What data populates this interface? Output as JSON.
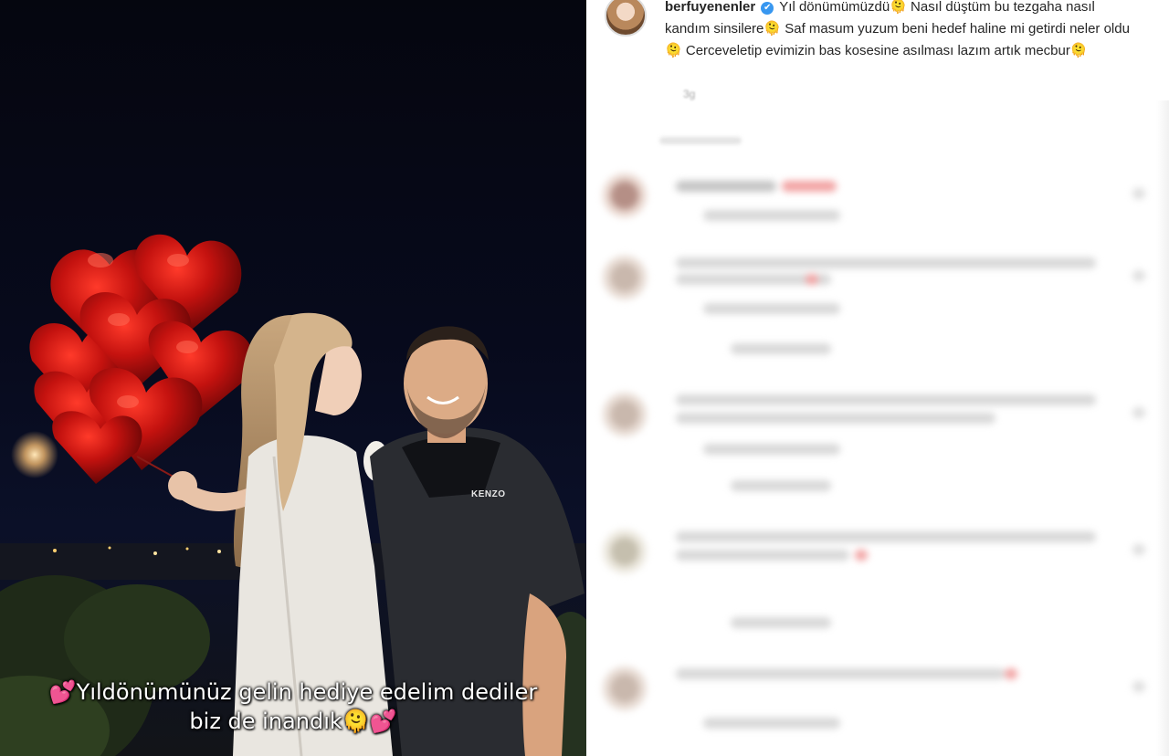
{
  "photo": {
    "overlay_caption": {
      "line1_prefix": "💕",
      "line1": "Yıldönümünüz gelin hediye edelim dediler",
      "line2": "biz de inandık",
      "line2_suffix_1": "🫠",
      "line2_suffix_2": "💕"
    },
    "shirt_logo": "KENZO"
  },
  "post": {
    "username": "berfuyenenler",
    "verified_mark": "✔",
    "caption_parts": [
      "Yıl dönümümüzdü",
      "Nasıl düştüm bu tezgaha nasıl kandım sinsilere",
      "Saf masum yuzum beni hedef haline mi getirdi neler oldu",
      "Cerceveletip evimizin bas kosesine asılması lazım artık mecbur"
    ],
    "caption_emoji": "🫠",
    "timestamp": "3g"
  },
  "colors": {
    "username": "#262626",
    "verified": "#3897f0",
    "night_sky": "#070a1c",
    "balloon": "#c4120f"
  }
}
